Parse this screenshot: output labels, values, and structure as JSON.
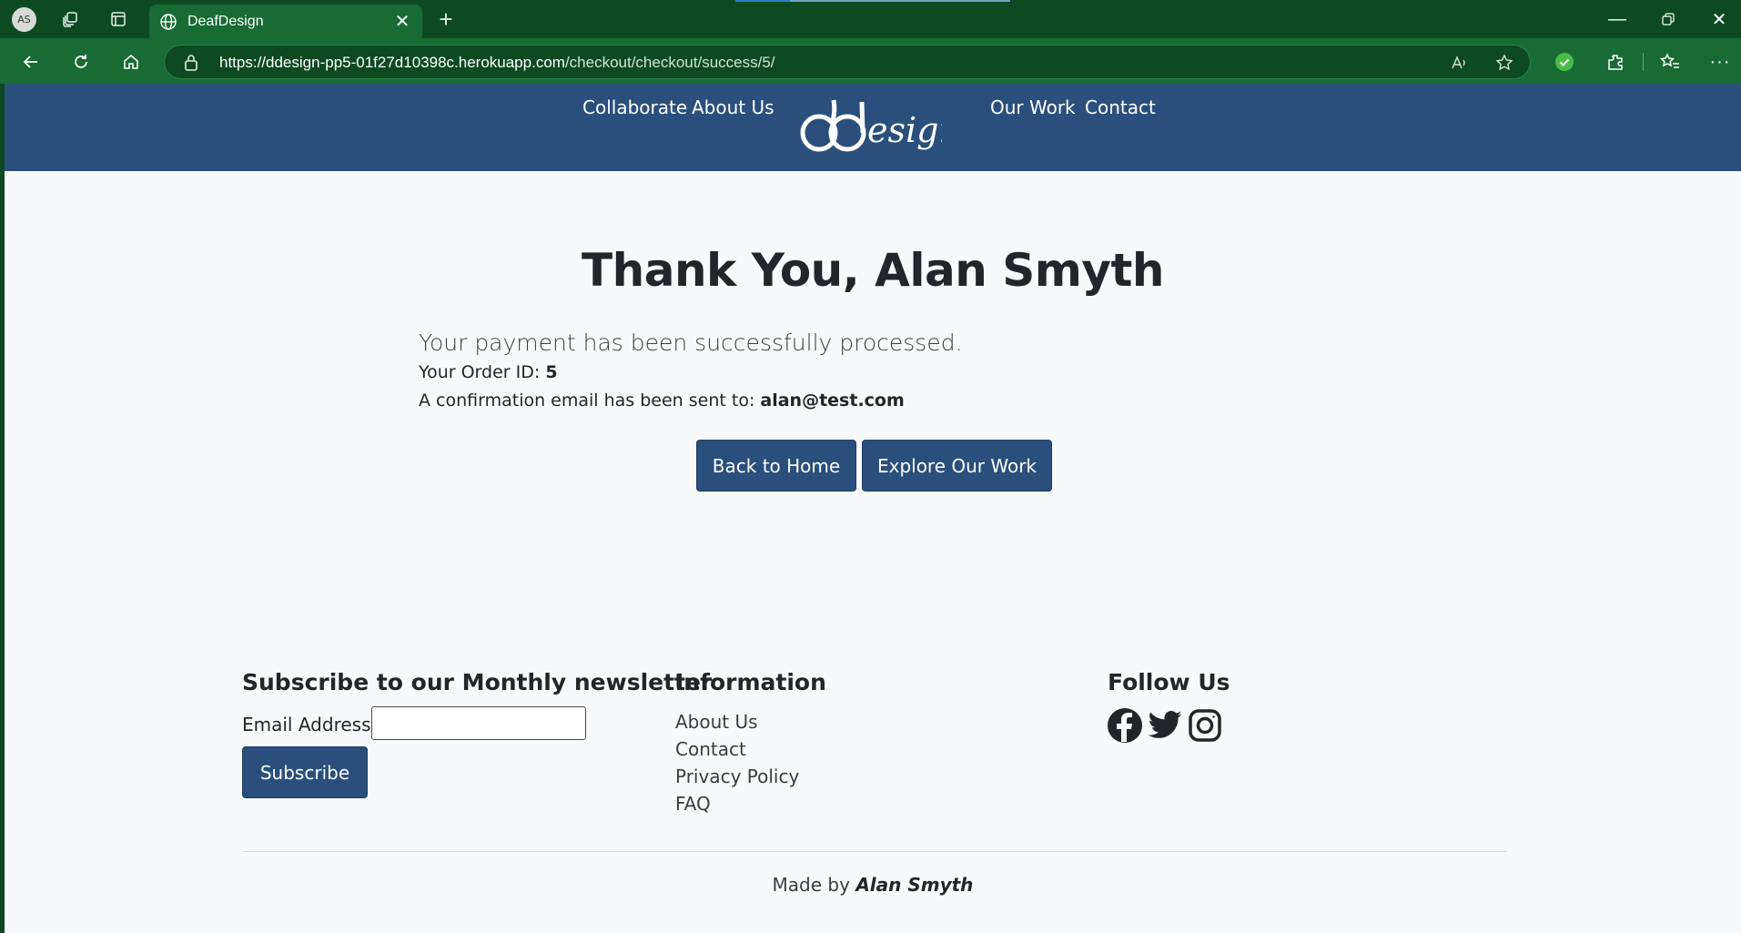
{
  "browser": {
    "profile_initials": "AS",
    "tab_title": "DeafDesign",
    "url_host": "https://ddesign-pp5-01f27d10398c.herokuapp.com",
    "url_path": "/checkout/checkout/success/5/"
  },
  "nav": {
    "left": [
      "Collaborate",
      "About Us"
    ],
    "right": [
      "Our Work",
      "Contact"
    ],
    "logo_text": "ddesign"
  },
  "success": {
    "title": "Thank You, Alan Smyth",
    "lead": "Your payment has been successfully processed.",
    "order_label": "Your Order ID: ",
    "order_id": "5",
    "email_label": "A confirmation email has been sent to: ",
    "email": "alan@test.com",
    "back_button": "Back to Home",
    "explore_button": "Explore Our Work"
  },
  "footer": {
    "newsletter_heading": "Subscribe to our Monthly newsletter",
    "email_label": "Email Address:*",
    "email_value": "",
    "subscribe_button": "Subscribe",
    "info_heading": "Information",
    "info_links": [
      "About Us",
      "Contact",
      "Privacy Policy",
      "FAQ"
    ],
    "follow_heading": "Follow Us",
    "social_icons": [
      "facebook-icon",
      "twitter-icon",
      "instagram-icon"
    ],
    "credit_prefix": "Made by ",
    "credit_name": "Alan Smyth"
  },
  "colors": {
    "browser_frame": "#0d4a22",
    "browser_toolbar": "#176b33",
    "header_bg": "#2a4f7c",
    "button_bg": "#2a4f7c",
    "page_bg": "#f8f9fa"
  }
}
